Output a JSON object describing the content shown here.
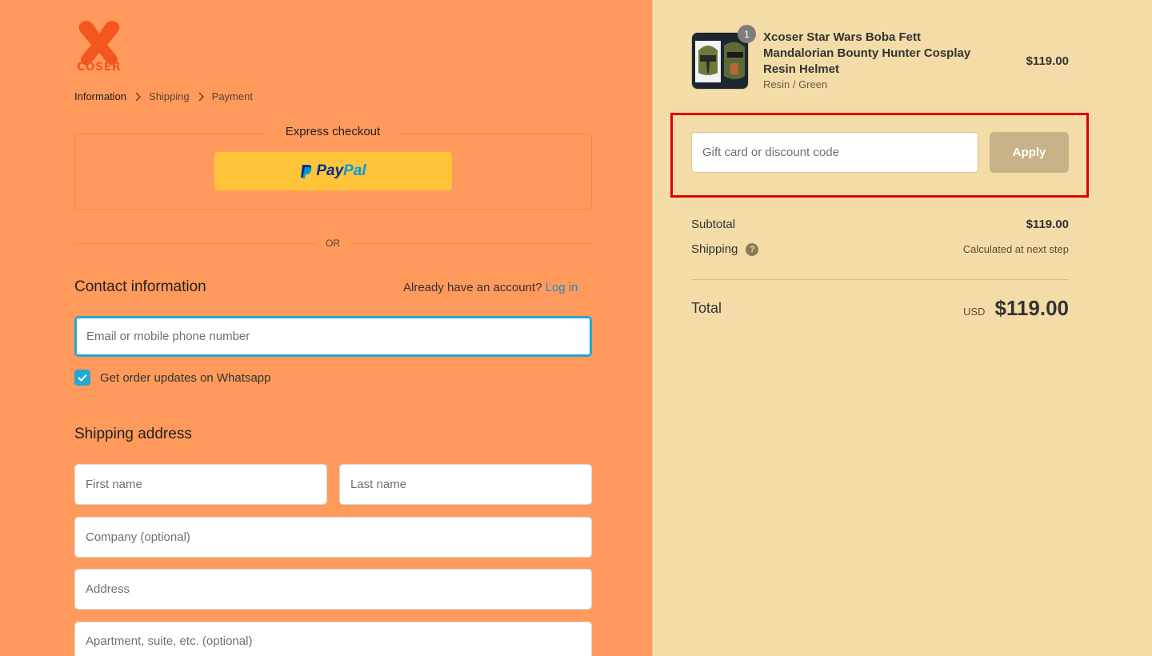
{
  "brand": {
    "logo_text": "COSER",
    "logo_color": "#f3571f"
  },
  "breadcrumb": {
    "items": [
      "Information",
      "Shipping",
      "Payment"
    ]
  },
  "express": {
    "title": "Express checkout",
    "paypal_left": "Pay",
    "paypal_right": "Pal"
  },
  "divider": {
    "or": "OR"
  },
  "contact": {
    "title": "Contact information",
    "account_prompt": "Already have an account?",
    "login_link": "Log in",
    "email_placeholder": "Email or mobile phone number",
    "whatsapp_label": "Get order updates on Whatsapp",
    "whatsapp_checked": true
  },
  "shipping": {
    "title": "Shipping address",
    "first_name_placeholder": "First name",
    "last_name_placeholder": "Last name",
    "company_placeholder": "Company (optional)",
    "address_placeholder": "Address",
    "apartment_placeholder": "Apartment, suite, etc. (optional)"
  },
  "cart": {
    "quantity_badge": "1",
    "product_title": "Xcoser Star Wars Boba Fett Mandalorian Bounty Hunter Cosplay Resin Helmet",
    "product_variant": "Resin / Green",
    "product_price": "$119.00"
  },
  "discount": {
    "placeholder": "Gift card or discount code",
    "apply_label": "Apply"
  },
  "summary": {
    "subtotal_label": "Subtotal",
    "subtotal_value": "$119.00",
    "shipping_label": "Shipping",
    "shipping_value": "Calculated at next step",
    "total_label": "Total",
    "total_currency": "USD",
    "total_value": "$119.00"
  },
  "colors": {
    "accent": "#23a7d3",
    "left_bg": "#ff9a5c",
    "right_bg": "#f4dca8",
    "highlight": "#e00000"
  }
}
